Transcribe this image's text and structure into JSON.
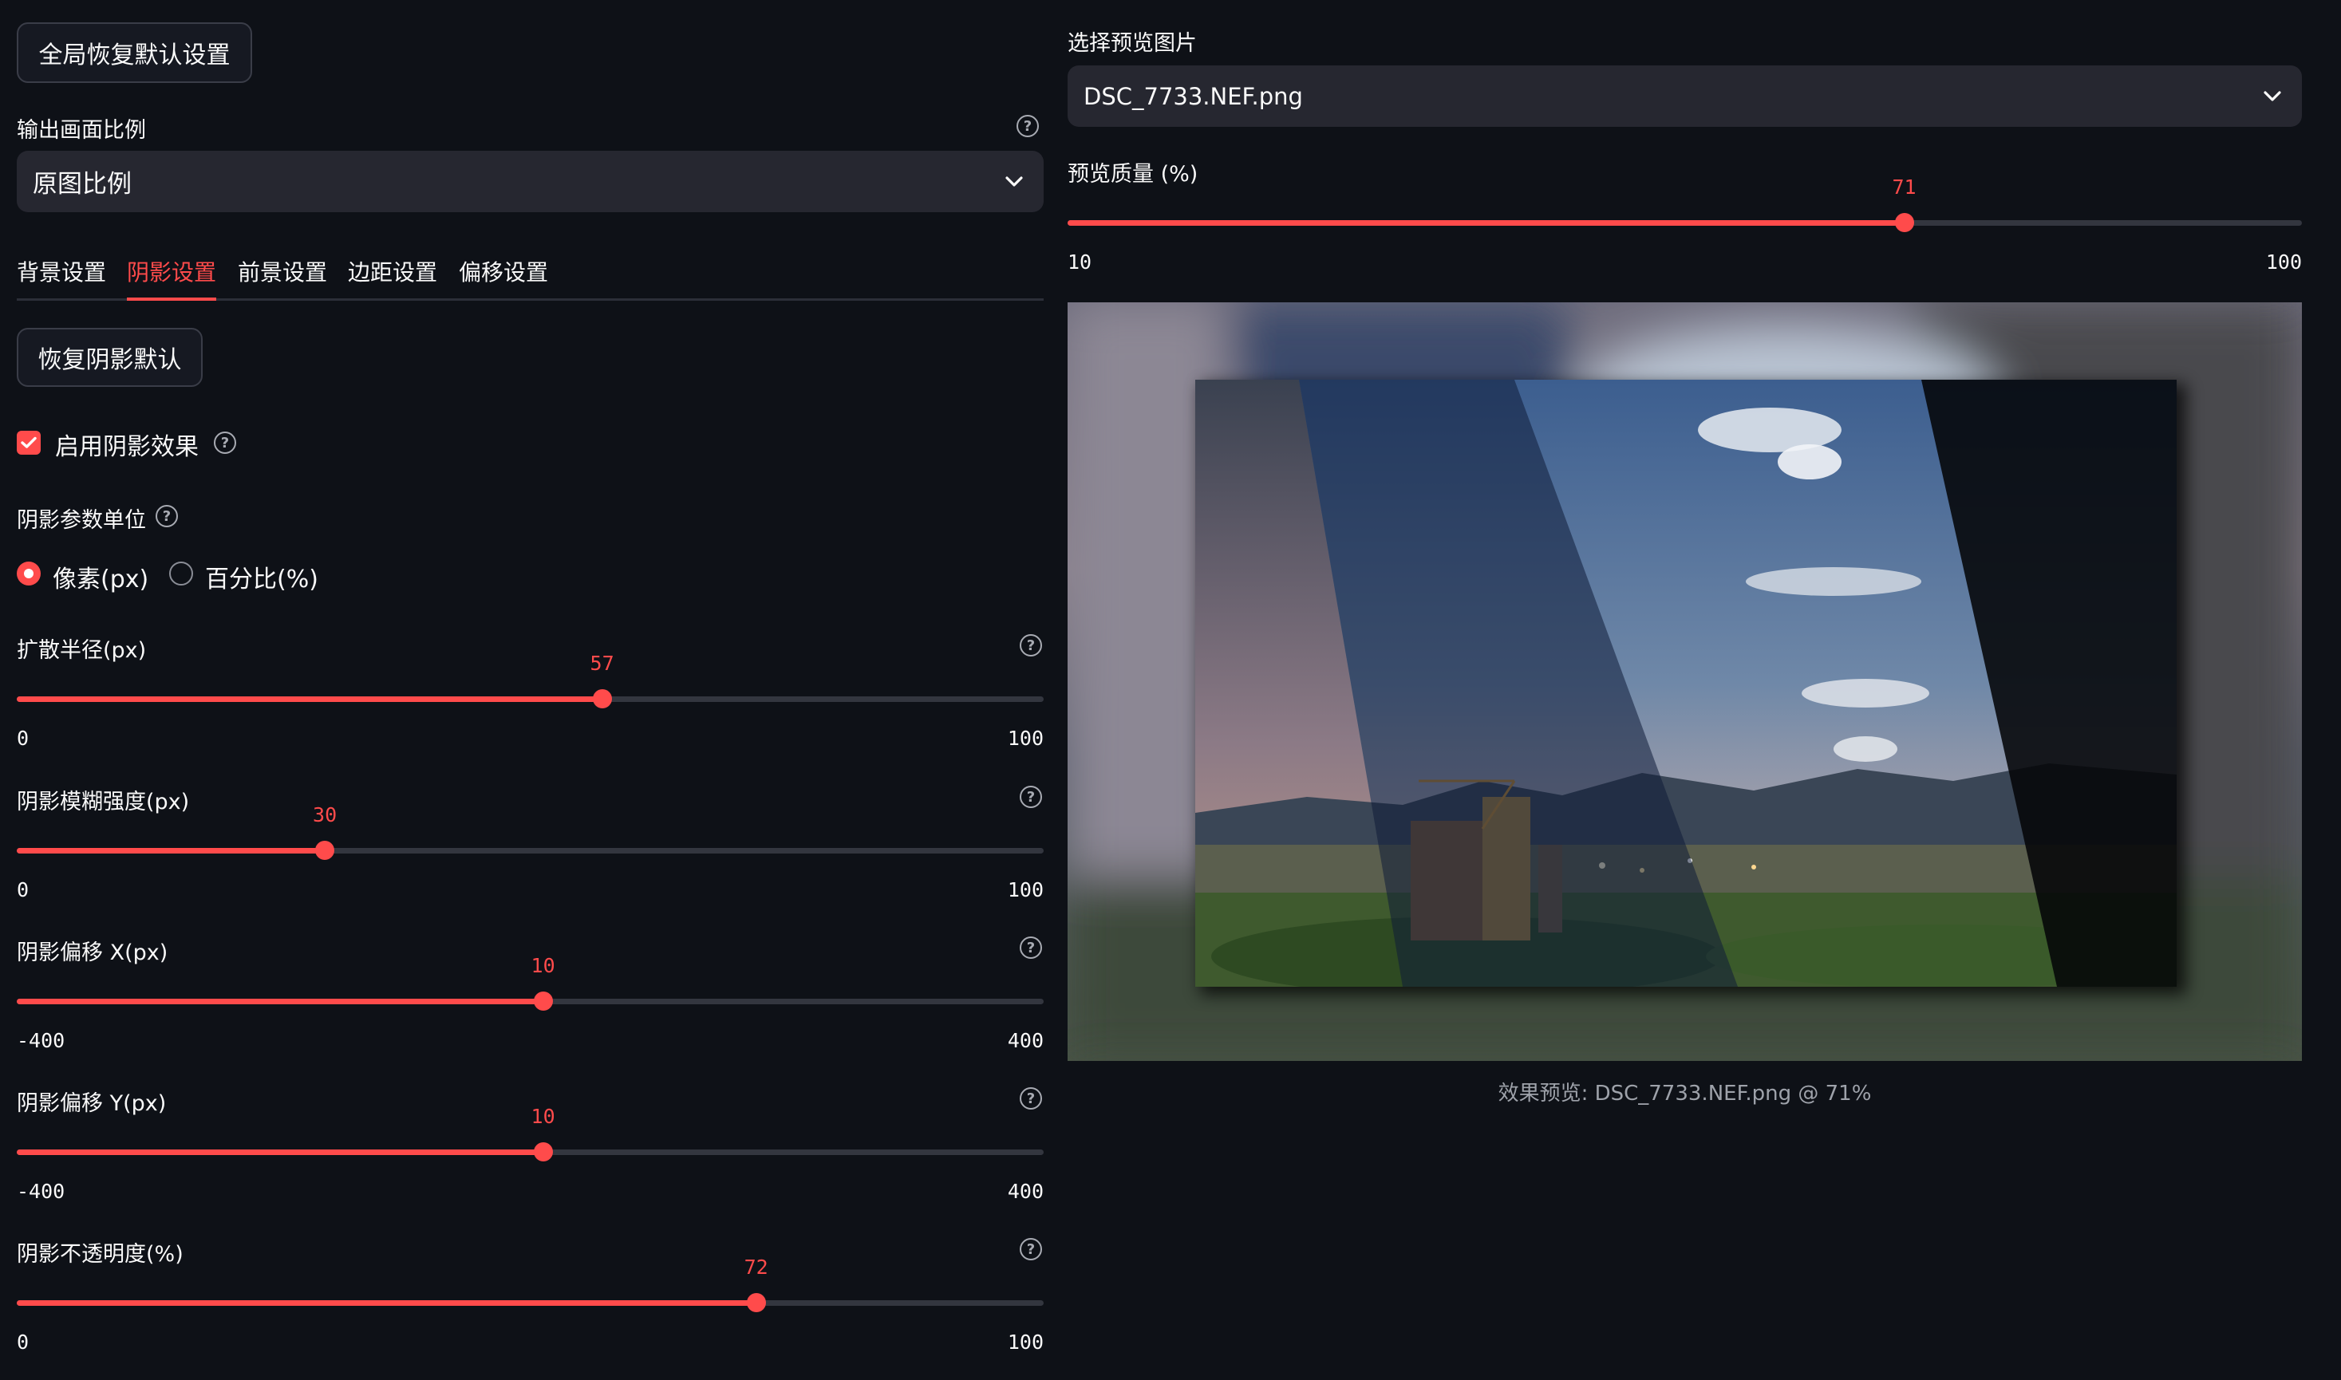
{
  "left": {
    "reset_all_label": "全局恢复默认设置",
    "aspect": {
      "label": "输出画面比例",
      "value": "原图比例"
    },
    "tabs": [
      {
        "label": "背景设置",
        "active": false
      },
      {
        "label": "阴影设置",
        "active": true
      },
      {
        "label": "前景设置",
        "active": false
      },
      {
        "label": "边距设置",
        "active": false
      },
      {
        "label": "偏移设置",
        "active": false
      }
    ],
    "reset_shadow_label": "恢复阴影默认",
    "enable_shadow": {
      "label": "启用阴影效果",
      "checked": true
    },
    "unit": {
      "label": "阴影参数单位",
      "options": [
        {
          "label": "像素(px)",
          "selected": true
        },
        {
          "label": "百分比(%)",
          "selected": false
        }
      ]
    },
    "sliders": [
      {
        "label": "扩散半径(px)",
        "value": 57,
        "min": 0,
        "max": 100
      },
      {
        "label": "阴影模糊强度(px)",
        "value": 30,
        "min": 0,
        "max": 100
      },
      {
        "label": "阴影偏移 X(px)",
        "value": 10,
        "min": -400,
        "max": 400
      },
      {
        "label": "阴影偏移 Y(px)",
        "value": 10,
        "min": -400,
        "max": 400
      },
      {
        "label": "阴影不透明度(%)",
        "value": 72,
        "min": 0,
        "max": 100
      }
    ]
  },
  "right": {
    "image_select": {
      "label": "选择预览图片",
      "value": "DSC_7733.NEF.png"
    },
    "quality": {
      "label": "预览质量 (%)",
      "value": 71,
      "min": 10,
      "max": 100
    },
    "caption": "效果预览: DSC_7733.NEF.png @ 71%"
  },
  "colors": {
    "accent": "#ff4b4b",
    "background": "#0e1117",
    "widget": "#262730"
  }
}
